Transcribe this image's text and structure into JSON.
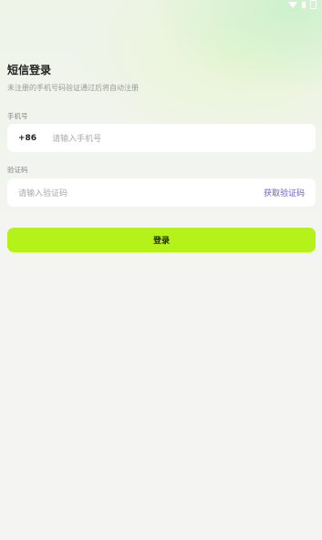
{
  "header": {
    "title": "短信登录",
    "subtitle": "未注册的手机号码验证通过后将自动注册"
  },
  "phone": {
    "label": "手机号",
    "prefix": "+86",
    "placeholder": "请输入手机号"
  },
  "code": {
    "label": "验证码",
    "placeholder": "请输入验证码",
    "get_code": "获取验证码"
  },
  "login_button": "登录",
  "colors": {
    "accent": "#b5f21a",
    "link": "#7060c8"
  }
}
